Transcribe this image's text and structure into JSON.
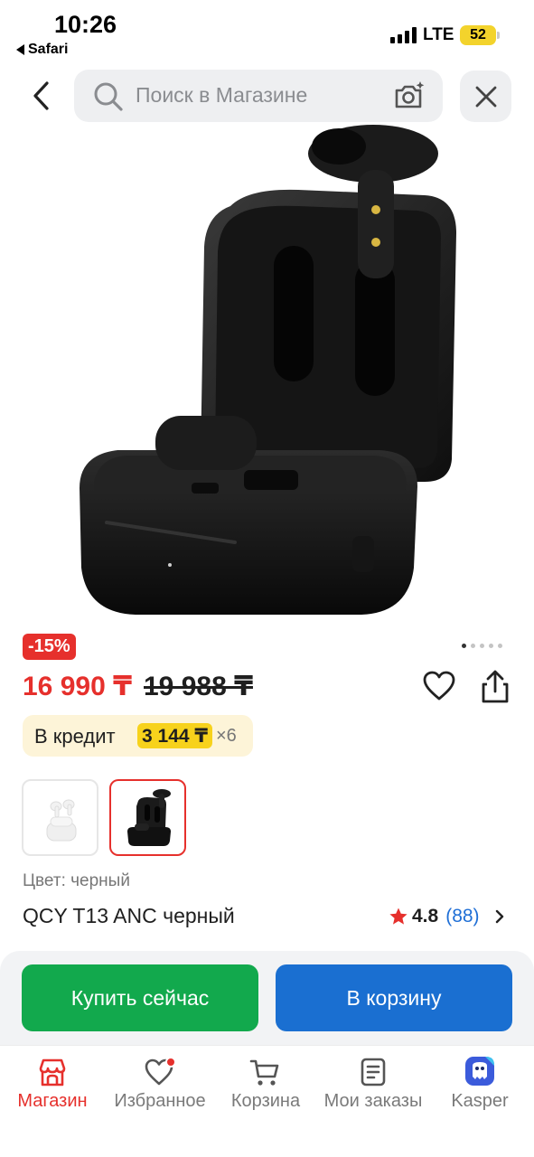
{
  "status_bar": {
    "time": "10:26",
    "back_app": "Safari",
    "network": "LTE",
    "battery": "52"
  },
  "search": {
    "placeholder": "Поиск в Магазине"
  },
  "product": {
    "discount_badge": "-15%",
    "price": "16 990 ₸",
    "old_price": "19 988 ₸",
    "credit": {
      "label": "В кредит",
      "amount": "3 144 ₸",
      "months": "×6"
    },
    "color_label": "Цвет: черный",
    "title": "QCY T13 ANC черный",
    "rating": "4.8",
    "reviews": "(88)",
    "gallery_dots": 5,
    "gallery_active_index": 0,
    "variants": [
      {
        "name": "white",
        "selected": false
      },
      {
        "name": "black",
        "selected": true
      }
    ]
  },
  "actions": {
    "buy_now": "Купить сейчас",
    "add_to_cart": "В корзину"
  },
  "tabs": [
    {
      "label": "Магазин",
      "icon": "shop-icon",
      "active": true
    },
    {
      "label": "Избранное",
      "icon": "heart-icon",
      "active": false
    },
    {
      "label": "Корзина",
      "icon": "cart-icon",
      "active": false
    },
    {
      "label": "Мои заказы",
      "icon": "orders-icon",
      "active": false
    },
    {
      "label": "Kasper",
      "icon": "kasper-icon",
      "active": false
    }
  ],
  "colors": {
    "accent_red": "#e6302c",
    "buy_green": "#12a94d",
    "cart_blue": "#1a6fd1",
    "credit_yellow": "#f7d21c"
  }
}
